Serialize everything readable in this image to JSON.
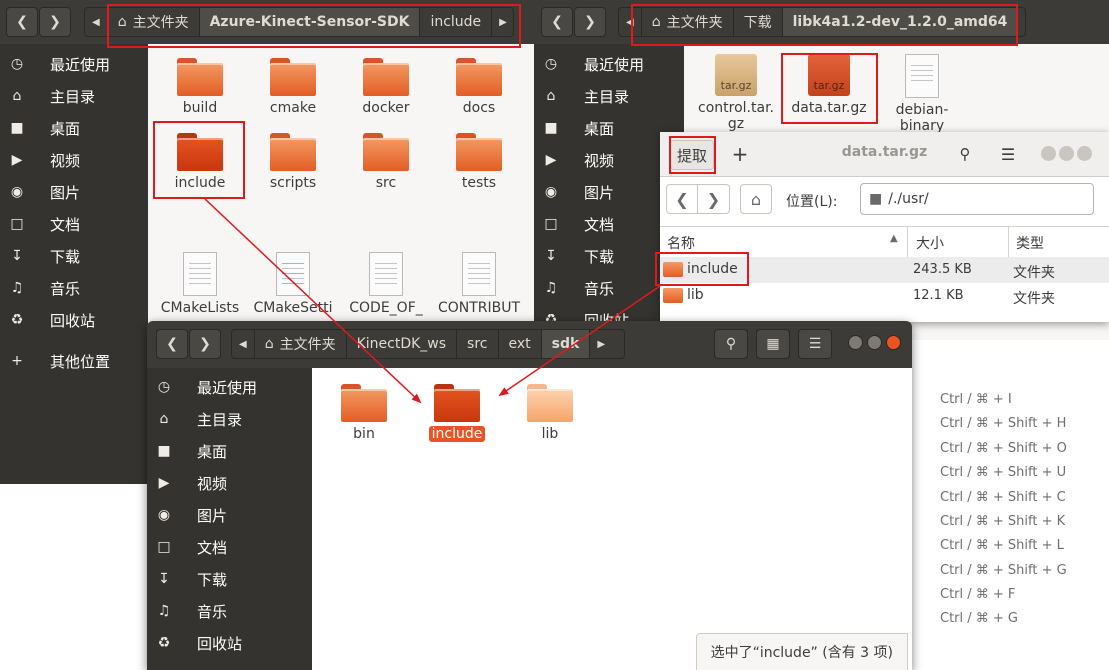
{
  "window_left": {
    "breadcrumbs": [
      "主文件夹",
      "Azure-Kinect-Sensor-SDK",
      "include"
    ],
    "sidebar": [
      {
        "icon": "clock-icon",
        "label": "最近使用"
      },
      {
        "icon": "home-icon",
        "label": "主目录"
      },
      {
        "icon": "folder-icon",
        "label": "桌面"
      },
      {
        "icon": "video-icon",
        "label": "视频"
      },
      {
        "icon": "camera-icon",
        "label": "图片"
      },
      {
        "icon": "document-icon",
        "label": "文档"
      },
      {
        "icon": "download-icon",
        "label": "下载"
      },
      {
        "icon": "music-icon",
        "label": "音乐"
      },
      {
        "icon": "trash-icon",
        "label": "回收站"
      },
      {
        "icon": "plus-icon",
        "label": "其他位置"
      }
    ],
    "files": [
      "build",
      "cmake",
      "docker",
      "docs",
      "include",
      "scripts",
      "src",
      "tests",
      "CMakeLists",
      "CMakeSetti",
      "CODE_OF_",
      "CONTRIBUT"
    ]
  },
  "window_right": {
    "breadcrumbs": [
      "主文件夹",
      "下载",
      "libk4a1.2-dev_1.2.0_amd64"
    ],
    "sidebar": [
      "最近使用",
      "主目录",
      "桌面",
      "视频",
      "图片",
      "文档",
      "下载",
      "音乐",
      "回收站"
    ],
    "files": [
      {
        "name": "control.tar.",
        "name2": "gz",
        "badge": "tar.gz"
      },
      {
        "name": "data.tar.gz",
        "badge": "tar.gz"
      },
      {
        "name": "debian-",
        "name2": "binary"
      }
    ]
  },
  "archive": {
    "extract_label": "提取",
    "add_label": "+",
    "title": "data.tar.gz",
    "location_label": "位置(L):",
    "location_value": "/./usr/",
    "columns": {
      "name": "名称",
      "size": "大小",
      "type": "类型"
    },
    "rows": [
      {
        "name": "include",
        "size": "243.5 KB",
        "type": "文件夹"
      },
      {
        "name": "lib",
        "size": "12.1 KB",
        "type": "文件夹"
      }
    ]
  },
  "window_front": {
    "breadcrumbs": [
      "主文件夹",
      "KinectDK_ws",
      "src",
      "ext",
      "sdk"
    ],
    "sidebar": [
      {
        "icon": "clock-icon",
        "label": "最近使用"
      },
      {
        "icon": "home-icon",
        "label": "主目录"
      },
      {
        "icon": "folder-icon",
        "label": "桌面"
      },
      {
        "icon": "video-icon",
        "label": "视频"
      },
      {
        "icon": "camera-icon",
        "label": "图片"
      },
      {
        "icon": "document-icon",
        "label": "文档"
      },
      {
        "icon": "download-icon",
        "label": "下载"
      },
      {
        "icon": "music-icon",
        "label": "音乐"
      },
      {
        "icon": "trash-icon",
        "label": "回收站"
      }
    ],
    "files": [
      "bin",
      "include",
      "lib"
    ],
    "status": "选中了“include” (含有 3 项)"
  },
  "shortcuts": [
    "Ctrl / ⌘ + I",
    "Ctrl / ⌘ + Shift + H",
    "Ctrl / ⌘ + Shift + O",
    "Ctrl / ⌘ + Shift + U",
    "Ctrl / ⌘ + Shift + C",
    "Ctrl / ⌘ + Shift + K",
    "Ctrl / ⌘ + Shift + L",
    "Ctrl / ⌘ + Shift + G",
    "Ctrl / ⌘ + F",
    "Ctrl / ⌘ + G"
  ],
  "colors": {
    "accent": "#e95420",
    "annotation": "#e0191d",
    "header": "#3d3b37",
    "sidebar": "#34332f"
  }
}
